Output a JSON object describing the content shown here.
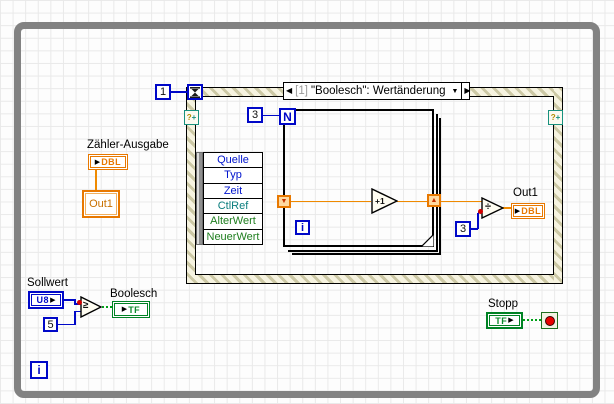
{
  "palette": {
    "loop_border_gray": "#828282",
    "structure_hatch_tan": "#ccc8a5",
    "wire_orange": "#ef8a00",
    "wire_blue": "#0008c8",
    "wire_green": "#00a018",
    "terminal_orange": "#e87800",
    "terminal_green": "#008224",
    "terminal_blue": "#0008c8",
    "stop_red": "#e80000"
  },
  "while_loop": {
    "iteration_label": "i"
  },
  "timeout_wait": {
    "constant": "1",
    "icon": "hourglass"
  },
  "event_structure": {
    "header": {
      "prev_arrow": "◀",
      "case_index": "[1]",
      "title": "\"Boolesch\": Wertänderung",
      "dropdown_arrow": "▼",
      "next_arrow": "▶"
    },
    "dynamic_terminal_glyph": "?",
    "dynamic_terminal_plus": "+",
    "event_data_node": {
      "rows": [
        {
          "label": "Quelle"
        },
        {
          "label": "Typ"
        },
        {
          "label": "Zeit"
        },
        {
          "label": "CtlRef"
        },
        {
          "label": "AlterWert"
        },
        {
          "label": "NeuerWert"
        }
      ]
    }
  },
  "for_loop": {
    "count_terminal": "N",
    "count_constant": "3",
    "iteration_label": "i",
    "shift_register_left": "▼",
    "shift_register_right": "▲",
    "increment_label": "+1"
  },
  "divide": {
    "glyph": "÷",
    "constant": "3"
  },
  "out1_indicator": {
    "label": "Out1",
    "arrow": "▶",
    "type": "DBL"
  },
  "counter_output": {
    "label": "Zähler-Ausgabe",
    "arrow": "▶",
    "type": "DBL",
    "node_label": "Out1"
  },
  "setpoint": {
    "label": "Sollwert",
    "type": "U8",
    "arrow": "▶",
    "constant": "5",
    "compare_glyph": "≥"
  },
  "boolean_indicator": {
    "label": "Boolesch",
    "arrow": "▶",
    "type": "TF"
  },
  "stop_control": {
    "label": "Stopp",
    "type": "TF",
    "arrow": "▶"
  }
}
